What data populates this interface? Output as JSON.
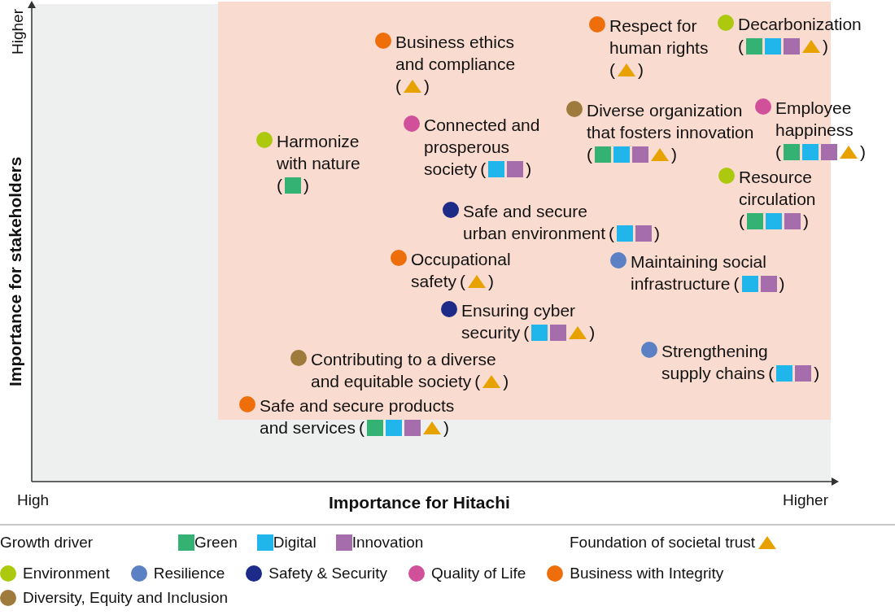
{
  "axes": {
    "y_title": "Importance for stakeholders",
    "y_high": "Higher",
    "x_title": "Importance for Hitachi",
    "x_low": "High",
    "x_high": "Higher"
  },
  "items": [
    {
      "lines": [
        "Business ethics",
        "and compliance"
      ],
      "color": "#ee6e0c",
      "open": "(",
      "close": ")",
      "tags_own_line": true,
      "drivers": [
        {
          "kind": "trust"
        }
      ]
    },
    {
      "lines": [
        "Respect for",
        "human rights"
      ],
      "color": "#ee6e0c",
      "open": "(",
      "close": ")",
      "tags_own_line": true,
      "drivers": [
        {
          "kind": "trust"
        }
      ]
    },
    {
      "lines": [
        "Decarbonization"
      ],
      "color": "#acc90e",
      "open": "(",
      "close": ")",
      "tags_own_line": true,
      "drivers": [
        {
          "kind": "green"
        },
        {
          "kind": "digital"
        },
        {
          "kind": "innovation"
        },
        {
          "kind": "trust"
        }
      ]
    },
    {
      "lines": [
        "Harmonize",
        "with nature"
      ],
      "color": "#acc90e",
      "open": "(",
      "close": ")",
      "tags_own_line": true,
      "drivers": [
        {
          "kind": "green"
        }
      ]
    },
    {
      "lines": [
        "Connected and",
        "prosperous",
        "society"
      ],
      "color": "#d0509a",
      "open": "(",
      "close": ")",
      "tags_own_line": false,
      "drivers": [
        {
          "kind": "digital"
        },
        {
          "kind": "innovation"
        }
      ]
    },
    {
      "lines": [
        "Diverse organization",
        "that fosters innovation"
      ],
      "color": "#9e7b3c",
      "open": "(",
      "close": ")",
      "tags_own_line": true,
      "drivers": [
        {
          "kind": "green"
        },
        {
          "kind": "digital"
        },
        {
          "kind": "innovation"
        },
        {
          "kind": "trust"
        }
      ]
    },
    {
      "lines": [
        "Employee",
        "happiness"
      ],
      "color": "#d0509a",
      "open": "(",
      "close": ")",
      "tags_own_line": true,
      "drivers": [
        {
          "kind": "green"
        },
        {
          "kind": "digital"
        },
        {
          "kind": "innovation"
        },
        {
          "kind": "trust"
        }
      ]
    },
    {
      "lines": [
        "Resource",
        "circulation"
      ],
      "color": "#acc90e",
      "open": "(",
      "close": ")",
      "tags_own_line": true,
      "drivers": [
        {
          "kind": "green"
        },
        {
          "kind": "digital"
        },
        {
          "kind": "innovation"
        }
      ]
    },
    {
      "lines": [
        "Safe and secure",
        "urban environment"
      ],
      "color": "#1e2a88",
      "open": "(",
      "close": ")",
      "tags_own_line": false,
      "drivers": [
        {
          "kind": "digital"
        },
        {
          "kind": "innovation"
        }
      ]
    },
    {
      "lines": [
        "Occupational",
        "safety"
      ],
      "color": "#ee6e0c",
      "open": "(",
      "close": ")",
      "tags_own_line": false,
      "drivers": [
        {
          "kind": "trust"
        }
      ]
    },
    {
      "lines": [
        "Maintaining social",
        "infrastructure"
      ],
      "color": "#5b80c4",
      "open": "(",
      "close": ")",
      "tags_own_line": false,
      "drivers": [
        {
          "kind": "digital"
        },
        {
          "kind": "innovation"
        }
      ]
    },
    {
      "lines": [
        "Ensuring cyber",
        "security"
      ],
      "color": "#1e2a88",
      "open": "(",
      "close": ")",
      "tags_own_line": false,
      "drivers": [
        {
          "kind": "digital"
        },
        {
          "kind": "innovation"
        },
        {
          "kind": "trust"
        }
      ]
    },
    {
      "lines": [
        "Contributing to a diverse",
        "and equitable society"
      ],
      "color": "#9e7b3c",
      "open": "(",
      "close": ")",
      "tags_own_line": false,
      "drivers": [
        {
          "kind": "trust"
        }
      ]
    },
    {
      "lines": [
        "Strengthening",
        "supply chains"
      ],
      "color": "#5b80c4",
      "open": "(",
      "close": ")",
      "tags_own_line": false,
      "drivers": [
        {
          "kind": "digital"
        },
        {
          "kind": "innovation"
        }
      ]
    },
    {
      "lines": [
        "Safe and secure products",
        "and services"
      ],
      "color": "#ee6e0c",
      "open": "(",
      "close": ")",
      "tags_own_line": false,
      "drivers": [
        {
          "kind": "green"
        },
        {
          "kind": "digital"
        },
        {
          "kind": "innovation"
        },
        {
          "kind": "trust"
        }
      ]
    }
  ],
  "legend": {
    "growth_title": "Growth driver",
    "drivers": [
      {
        "kind": "green",
        "label": "Green"
      },
      {
        "kind": "digital",
        "label": "Digital"
      },
      {
        "kind": "innovation",
        "label": "Innovation"
      }
    ],
    "trust": {
      "kind": "trust",
      "label": "Foundation of societal trust"
    },
    "categories": [
      {
        "label": "Environment",
        "color": "#acc90e"
      },
      {
        "label": "Resilience",
        "color": "#5b80c4"
      },
      {
        "label": "Safety & Security",
        "color": "#1e2a88"
      },
      {
        "label": "Quality of Life",
        "color": "#d0509a"
      },
      {
        "label": "Business with Integrity",
        "color": "#ee6e0c"
      },
      {
        "label": "Diversity, Equity and Inclusion",
        "color": "#9e7b3c"
      }
    ]
  }
}
